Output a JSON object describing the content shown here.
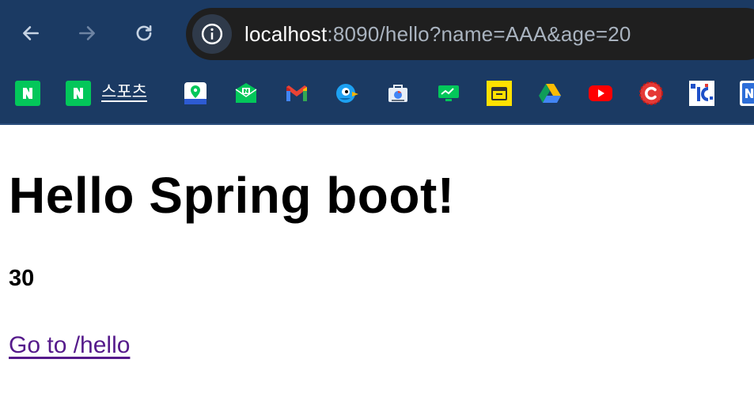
{
  "browser": {
    "url_host": "localhost",
    "url_rest": ":8090/hello?name=AAA&age=20",
    "back_icon": "arrow-left-icon",
    "forward_icon": "arrow-right-icon",
    "reload_icon": "reload-icon",
    "site_info_icon": "info-icon",
    "bookmarks": [
      {
        "icon": "naver-icon",
        "label": ""
      },
      {
        "icon": "naver-icon",
        "label": "스포츠"
      },
      {
        "icon": "naver-map-icon",
        "label": ""
      },
      {
        "icon": "naver-mail-icon",
        "label": ""
      },
      {
        "icon": "gmail-icon",
        "label": ""
      },
      {
        "icon": "bird-icon",
        "label": ""
      },
      {
        "icon": "web-store-icon",
        "label": ""
      },
      {
        "icon": "green-chart-icon",
        "label": ""
      },
      {
        "icon": "yellow-box-icon",
        "label": ""
      },
      {
        "icon": "google-drive-icon",
        "label": ""
      },
      {
        "icon": "youtube-icon",
        "label": ""
      },
      {
        "icon": "red-c-icon",
        "label": ""
      },
      {
        "icon": "pixel-logo-icon",
        "label": ""
      },
      {
        "icon": "nh-icon",
        "label": ""
      }
    ]
  },
  "page": {
    "heading": "Hello Spring boot!",
    "value": "30",
    "link_text": "Go to /hello"
  },
  "colors": {
    "chrome_bg": "#1b3a63",
    "omnibox_bg": "#1f1f1f",
    "link_visited": "#551a8b"
  }
}
